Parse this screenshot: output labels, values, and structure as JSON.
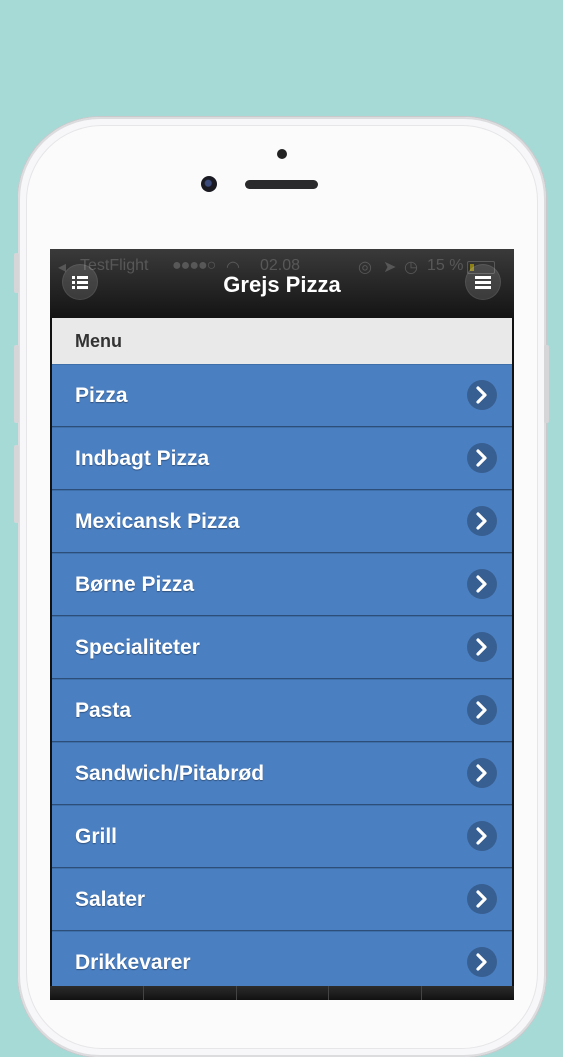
{
  "status_bar": {
    "carrier": "TestFlight",
    "signal": "●●●●○",
    "time": "02.08",
    "battery": "15 %"
  },
  "header": {
    "title": "Grejs Pizza",
    "left_icon": "list-icon",
    "right_icon": "menu-icon"
  },
  "section": {
    "title": "Menu"
  },
  "menu": {
    "items": [
      {
        "label": "Pizza"
      },
      {
        "label": "Indbagt Pizza"
      },
      {
        "label": "Mexicansk Pizza"
      },
      {
        "label": "Børne Pizza"
      },
      {
        "label": "Specialiteter"
      },
      {
        "label": "Pasta"
      },
      {
        "label": "Sandwich/Pitabrød"
      },
      {
        "label": "Grill"
      },
      {
        "label": "Salater"
      },
      {
        "label": "Drikkevarer"
      }
    ]
  },
  "colors": {
    "background": "#a6dad6",
    "list_item": "#4a7fc2",
    "header": "#1c1c1c"
  }
}
